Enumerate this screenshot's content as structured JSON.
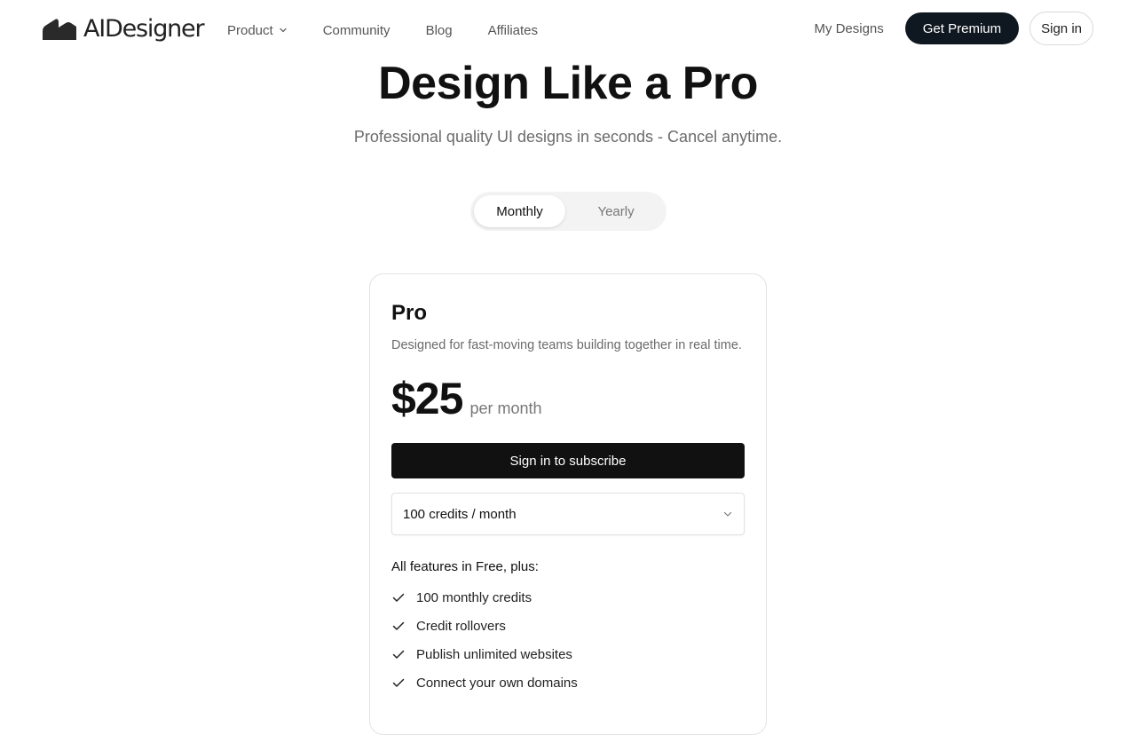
{
  "brand": {
    "name": "AIDesigner"
  },
  "nav": {
    "links": [
      {
        "label": "Product",
        "has_dropdown": true
      },
      {
        "label": "Community"
      },
      {
        "label": "Blog"
      },
      {
        "label": "Affiliates"
      }
    ],
    "my_designs": "My Designs",
    "premium_button": "Get Premium",
    "signin_button": "Sign in"
  },
  "hero": {
    "title": "Design Like a Pro",
    "subtitle": "Professional quality UI designs in seconds - Cancel anytime."
  },
  "billing_toggle": {
    "options": [
      "Monthly",
      "Yearly"
    ],
    "selected": "Monthly"
  },
  "plan": {
    "name": "Pro",
    "description": "Designed for fast-moving teams building together in real time.",
    "price": "$25",
    "period": "per month",
    "cta": "Sign in to subscribe",
    "credits_selected": "100 credits / month",
    "features_heading": "All features in Free, plus:",
    "features": [
      "100 monthly credits",
      "Credit rollovers",
      "Publish unlimited websites",
      "Connect your own domains"
    ]
  },
  "colors": {
    "primary_dark": "#0f1720",
    "button_black": "#111111",
    "muted_text": "#6b6b6b",
    "border": "#e3e3e3",
    "toggle_bg": "#f3f3f3"
  },
  "icons": {
    "logo": "brand-logo-icon",
    "product_dropdown": "chevron-down-icon",
    "credits_dropdown": "chevron-down-icon",
    "feature_bullet": "check-icon"
  }
}
